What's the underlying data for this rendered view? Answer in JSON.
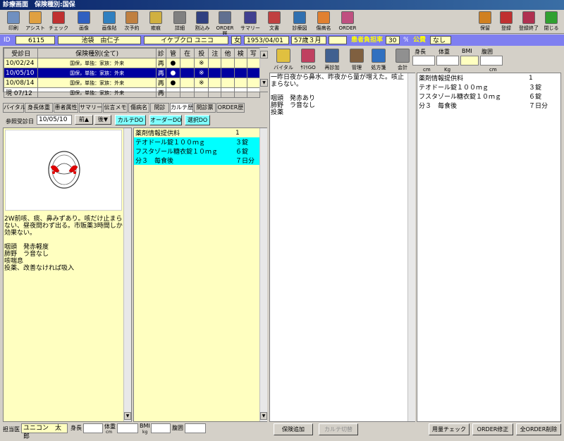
{
  "title": "診療画面　保険種別:国保",
  "toolbar": {
    "left": [
      "印刷",
      "アシスト",
      "チェック",
      "画像",
      "画像貼",
      "次予約",
      "癒痕",
      "詳細",
      "割込み",
      "ORDER履",
      "サマリー",
      "文書",
      "診療図",
      "傷病名",
      "ORDER"
    ],
    "right": [
      "保留",
      "登録",
      "登録終了",
      "閉じる"
    ]
  },
  "patient": {
    "id_label": "ID",
    "id": "6115",
    "name": "池袋　由仁子",
    "kana": "イケブクロ ユニコ",
    "sex": "女",
    "birth": "1953/04/01",
    "age": "57歳３月",
    "burden_label": "患者負担率",
    "burden": "30",
    "percent": "%",
    "public_label": "公費",
    "public": "なし"
  },
  "visits": {
    "headers": [
      "受診日",
      "保険種別(全て)",
      "診",
      "管",
      "在",
      "投",
      "注",
      "他",
      "検",
      "写"
    ],
    "rows": [
      [
        "10/02/24",
        "国保，単独：家族：外来",
        "再",
        "●",
        "",
        "※",
        "",
        "",
        "",
        ""
      ],
      [
        "10/05/10",
        "国保，単独：家族：外来",
        "再",
        "●",
        "",
        "※",
        "",
        "",
        "",
        ""
      ],
      [
        "10/08/14",
        "国保，単独：家族：外来",
        "再",
        "●",
        "",
        "※",
        "",
        "",
        "",
        ""
      ],
      [
        "現 07/12",
        "国保，単独：家族：外来",
        "再",
        "",
        "",
        "",
        "",
        "",
        "",
        ""
      ]
    ]
  },
  "tabs": [
    "バイタル",
    "身長体重",
    "患者属性",
    "サマリー",
    "伝言メモ",
    "傷病名",
    "問診",
    "カルテ歴",
    "問診票",
    "ORDER歴"
  ],
  "ref": {
    "label": "参照受診日",
    "date": "10/05/10",
    "prev": "前▲",
    "next": "後▼",
    "karte_do": "カルテDO",
    "order_do": "オーダーDO",
    "select_do": "選択DO"
  },
  "history_text": "2W前咳、痰、鼻みずあり。咳だけ止まらない、昼夜問わず出る。市販薬3時間しか効果ない。\n\n咽頭　発赤軽度\n肺野　ラ音なし\n咳喘息\n投薬、改善なければ吸入",
  "history_orders": [
    [
      "薬剤情報提供料",
      "1"
    ],
    [
      "テオドール錠１００ｍｇ",
      "３錠"
    ],
    [
      "フスタゾール糖衣錠１０ｍｇ",
      "６錠"
    ],
    [
      "分３　毎食後",
      "７日分"
    ]
  ],
  "mid_icons": [
    "バイタル",
    "ｻﾏﾘGO",
    "再診加",
    "管理",
    "処方箋",
    "会計"
  ],
  "current_text": "一昨日夜から鼻水、昨夜から量が増えた。咳止まらない。\n\n咽頭　発赤あり\n肺野　ラ音なし\n投薬",
  "measure": {
    "height": "身長",
    "weight": "体重",
    "bmi": "BMI",
    "waist": "腹囲",
    "cm": "cm",
    "kg": "Kg",
    "cm2": "cm"
  },
  "current_orders": [
    [
      "薬剤情報提供料",
      "1"
    ],
    [
      "テオドール錠１００ｍｇ",
      "３錠"
    ],
    [
      "フスタゾール糖衣錠１０ｍｇ",
      "６錠"
    ],
    [
      "分３　毎食後",
      "７日分"
    ]
  ],
  "footer": {
    "doctor_label": "担当医",
    "doctor": "ユニコン　太郎",
    "height": "身長",
    "weight": "体重",
    "bmi": "BMI",
    "waist": "腹囲",
    "cm": "cm",
    "kg": "kg",
    "ins_add": "保険追加",
    "karte_switch": "カルテ切替",
    "dose_check": "用量チェック",
    "order_fix": "ORDER修正",
    "order_delete": "全ORDER削除"
  }
}
